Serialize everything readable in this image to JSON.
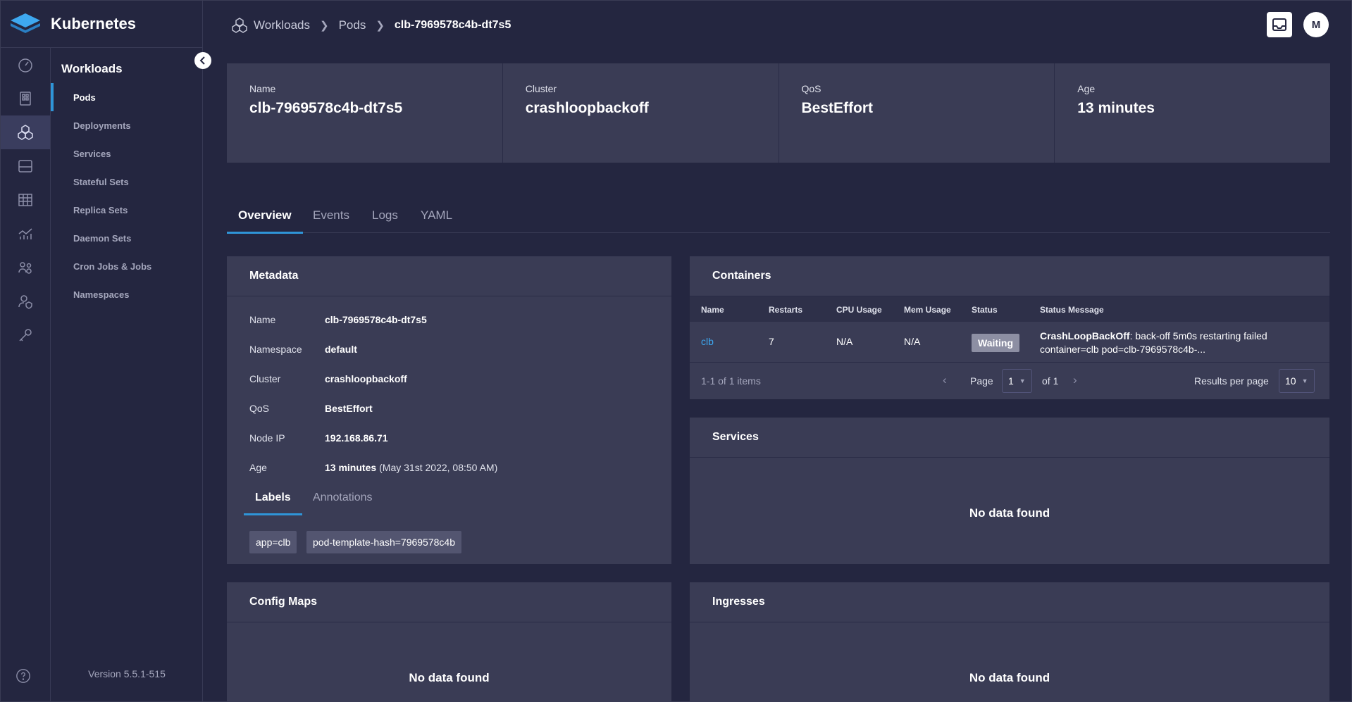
{
  "app": {
    "title": "Kubernetes"
  },
  "rail": {
    "icons": [
      "dashboard-icon",
      "cluster-icon",
      "workloads-icon",
      "storage-icon",
      "table-icon",
      "monitoring-icon",
      "users-icon",
      "access-icon",
      "key-icon"
    ],
    "active_index": 2,
    "help_icon": "help-icon"
  },
  "nav": {
    "heading": "Workloads",
    "items": [
      {
        "label": "Pods",
        "active": true
      },
      {
        "label": "Deployments"
      },
      {
        "label": "Services"
      },
      {
        "label": "Stateful Sets"
      },
      {
        "label": "Replica Sets"
      },
      {
        "label": "Daemon Sets"
      },
      {
        "label": "Cron Jobs & Jobs"
      },
      {
        "label": "Namespaces"
      }
    ],
    "version": "Version 5.5.1-515"
  },
  "breadcrumb": {
    "items": [
      "Workloads",
      "Pods"
    ],
    "current": "clb-7969578c4b-dt7s5"
  },
  "user": {
    "avatar_initial": "M"
  },
  "summary": [
    {
      "label": "Name",
      "value": "clb-7969578c4b-dt7s5"
    },
    {
      "label": "Cluster",
      "value": "crashloopbackoff"
    },
    {
      "label": "QoS",
      "value": "BestEffort"
    },
    {
      "label": "Age",
      "value": "13 minutes"
    }
  ],
  "tabs": [
    {
      "label": "Overview",
      "active": true
    },
    {
      "label": "Events"
    },
    {
      "label": "Logs"
    },
    {
      "label": "YAML"
    }
  ],
  "metadata": {
    "title": "Metadata",
    "rows": [
      {
        "key": "Name",
        "value": "clb-7969578c4b-dt7s5"
      },
      {
        "key": "Namespace",
        "value": "default"
      },
      {
        "key": "Cluster",
        "value": "crashloopbackoff"
      },
      {
        "key": "QoS",
        "value": "BestEffort"
      },
      {
        "key": "Node IP",
        "value": "192.168.86.71"
      },
      {
        "key": "Age",
        "value": "13 minutes",
        "extra": "(May 31st 2022, 08:50 AM)"
      }
    ],
    "sub_tabs": [
      {
        "label": "Labels",
        "active": true
      },
      {
        "label": "Annotations"
      }
    ],
    "labels": [
      "app=clb",
      "pod-template-hash=7969578c4b"
    ]
  },
  "containers": {
    "title": "Containers",
    "columns": [
      "Name",
      "Restarts",
      "CPU Usage",
      "Mem Usage",
      "Status",
      "Status Message"
    ],
    "rows": [
      {
        "name": "clb",
        "restarts": "7",
        "cpu": "N/A",
        "mem": "N/A",
        "status": "Waiting",
        "message_bold": "CrashLoopBackOff",
        "message_rest": ": back-off 5m0s restarting failed container=clb pod=clb-7969578c4b-..."
      }
    ],
    "pager": {
      "summary": "1-1 of 1 items",
      "page_label": "Page",
      "page_value": "1",
      "of_label": "of 1",
      "per_page_label": "Results per page",
      "per_page_value": "10"
    }
  },
  "services": {
    "title": "Services",
    "empty": "No data found"
  },
  "config_maps": {
    "title": "Config Maps",
    "empty": "No data found"
  },
  "ingresses": {
    "title": "Ingresses",
    "empty": "No data found"
  },
  "colors": {
    "background": "#242640",
    "panel": "#3a3c55",
    "accent": "#2f95d8",
    "link": "#3da7ef",
    "badge": "#8d8fa3"
  }
}
